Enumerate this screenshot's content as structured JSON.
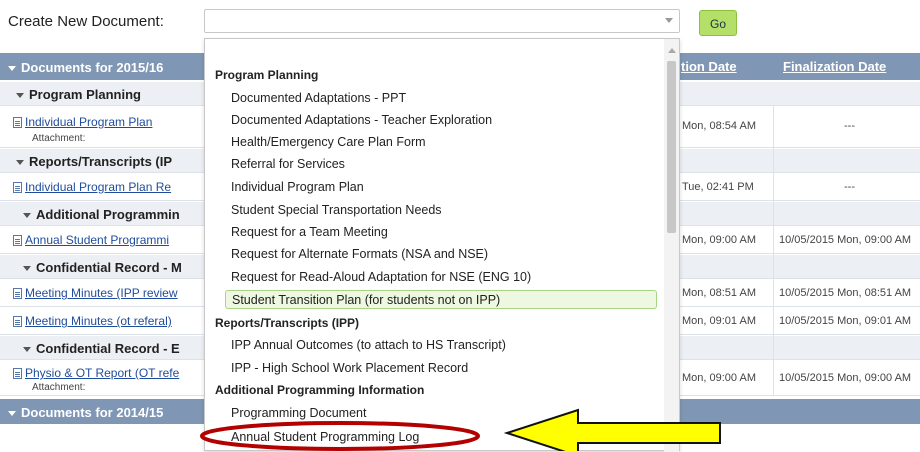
{
  "toolbar": {
    "create_label": "Create New Document:",
    "select_value": "",
    "go_label": "Go"
  },
  "table": {
    "year_header_1": "Documents for 2015/16",
    "year_header_2": "Documents for 2014/15",
    "col_creation": "tion Date",
    "col_finalization": "Finalization Date",
    "sections": [
      {
        "title": "Program Planning"
      },
      {
        "title": "Reports/Transcripts (IP"
      },
      {
        "title": "Additional Programmin"
      },
      {
        "title": "Confidential Record - M"
      },
      {
        "title": "Confidential Record - E"
      }
    ],
    "docs": [
      {
        "name": "Individual Program Plan",
        "attachment": "Attachment:",
        "creation": "Mon, 08:54 AM",
        "final": "---"
      },
      {
        "name": "Individual Program Plan Re",
        "attachment": "",
        "creation": "Tue, 02:41 PM",
        "final": "---"
      },
      {
        "name": "Annual Student Programmi",
        "attachment": "",
        "creation": "Mon, 09:00 AM",
        "final": "10/05/2015 Mon, 09:00 AM"
      },
      {
        "name": "Meeting Minutes (IPP review",
        "attachment": "",
        "creation": "Mon, 08:51 AM",
        "final": "10/05/2015 Mon, 08:51 AM"
      },
      {
        "name": "Meeting Minutes (ot referal)",
        "attachment": "",
        "creation": "Mon, 09:01 AM",
        "final": "10/05/2015 Mon, 09:01 AM"
      },
      {
        "name": "Physio & OT Report (OT refe",
        "attachment": "Attachment:",
        "creation": "Mon, 09:00 AM",
        "final": "10/05/2015 Mon, 09:00 AM"
      }
    ]
  },
  "dropdown": {
    "groups": [
      {
        "label": "Program Planning",
        "items": [
          "Documented Adaptations - PPT",
          "Documented Adaptations - Teacher Exploration",
          "Health/Emergency Care Plan Form",
          "Referral for Services",
          "Individual Program Plan",
          "Student Special Transportation Needs",
          "Request for a Team Meeting",
          "Request for Alternate Formats (NSA and NSE)",
          "Request for Read-Aloud Adaptation for NSE (ENG 10)",
          "Student Transition Plan (for students not on IPP)"
        ]
      },
      {
        "label": "Reports/Transcripts (IPP)",
        "items": [
          "IPP Annual Outcomes (to attach to HS Transcript)",
          "IPP - High School Work Placement Record"
        ]
      },
      {
        "label": "Additional Programming Information",
        "items": [
          "Programming Document",
          "Annual Student Programming Log"
        ]
      }
    ],
    "highlighted_item": "Student Transition Plan (for students not on IPP)"
  },
  "colors": {
    "header_bg": "#7f97b4",
    "go_button": "#b4e06a",
    "annotation_ellipse": "#b30000",
    "annotation_arrow": "#ffff00"
  }
}
